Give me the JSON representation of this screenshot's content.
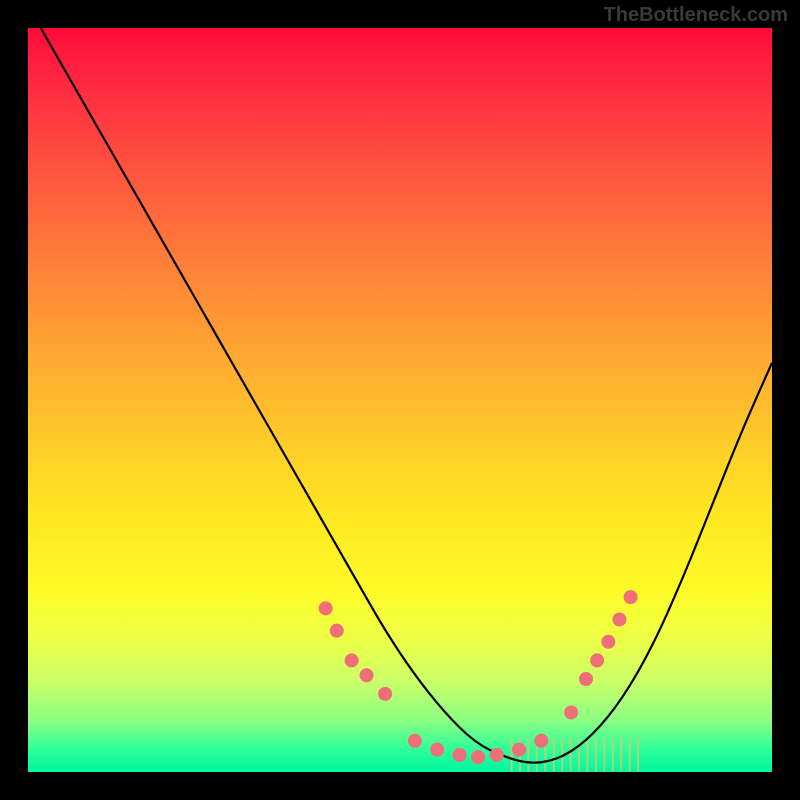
{
  "watermark": "TheBottleneck.com",
  "chart_data": {
    "type": "line",
    "title": "",
    "xlabel": "",
    "ylabel": "",
    "xlim": [
      0,
      100
    ],
    "ylim": [
      0,
      100
    ],
    "series": [
      {
        "name": "curve",
        "x": [
          0,
          4,
          8,
          12,
          16,
          20,
          24,
          28,
          32,
          36,
          40,
          44,
          48,
          52,
          56,
          60,
          64,
          68,
          72,
          76,
          80,
          84,
          88,
          92,
          96,
          100
        ],
        "y": [
          103,
          96,
          89,
          82,
          75,
          68,
          61,
          54,
          47,
          40,
          33,
          26,
          19,
          13,
          8,
          4,
          2,
          1,
          2,
          5,
          10,
          17,
          26,
          36,
          46,
          55
        ]
      }
    ],
    "markers": {
      "name": "dots",
      "color": "#ef6e78",
      "radius": 7,
      "points": [
        {
          "x": 40.0,
          "y": 22.0
        },
        {
          "x": 41.5,
          "y": 19.0
        },
        {
          "x": 43.5,
          "y": 15.0
        },
        {
          "x": 45.5,
          "y": 13.0
        },
        {
          "x": 48.0,
          "y": 10.5
        },
        {
          "x": 52.0,
          "y": 4.2
        },
        {
          "x": 55.0,
          "y": 3.0
        },
        {
          "x": 58.0,
          "y": 2.3
        },
        {
          "x": 60.5,
          "y": 2.0
        },
        {
          "x": 63.0,
          "y": 2.3
        },
        {
          "x": 66.0,
          "y": 3.0
        },
        {
          "x": 69.0,
          "y": 4.2
        },
        {
          "x": 73.0,
          "y": 8.0
        },
        {
          "x": 75.0,
          "y": 12.5
        },
        {
          "x": 76.5,
          "y": 15.0
        },
        {
          "x": 78.0,
          "y": 17.5
        },
        {
          "x": 79.5,
          "y": 20.5
        },
        {
          "x": 81.0,
          "y": 23.5
        }
      ]
    },
    "tick_band": {
      "name": "green-ticks",
      "color": "#f6bd63",
      "y_top": 4.5,
      "y_bottom": 0,
      "x_start": 65,
      "x_end": 82,
      "count": 16
    }
  }
}
